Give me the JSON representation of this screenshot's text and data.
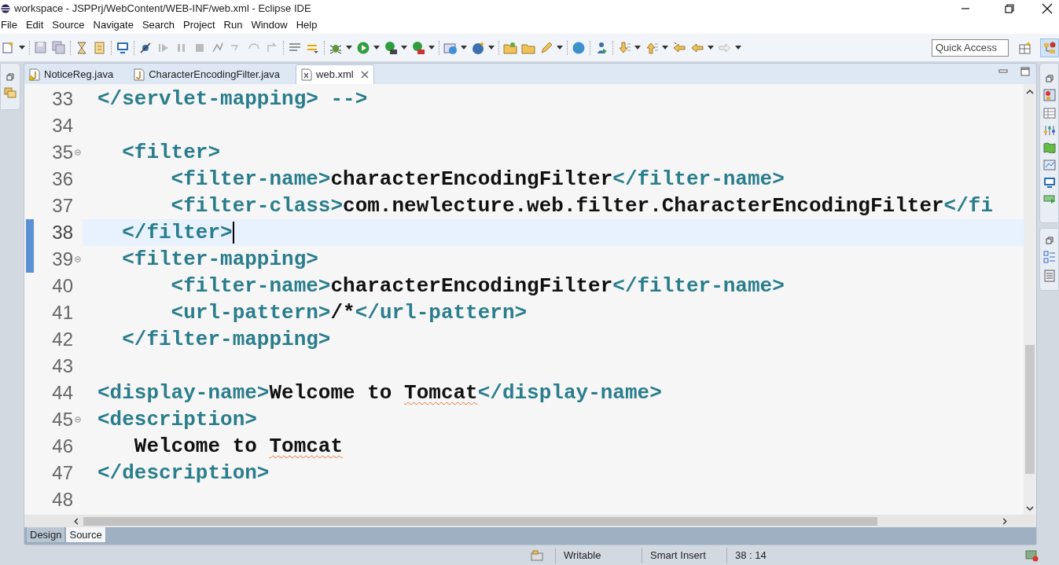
{
  "window": {
    "title": "workspace - JSPPrj/WebContent/WEB-INF/web.xml - Eclipse IDE"
  },
  "menu": [
    "File",
    "Edit",
    "Source",
    "Navigate",
    "Search",
    "Project",
    "Run",
    "Window",
    "Help"
  ],
  "quick_access": {
    "placeholder": "Quick Access"
  },
  "editor_tabs": [
    {
      "label": "NoticeReg.java",
      "kind": "java",
      "selected": false,
      "warning": true
    },
    {
      "label": "CharacterEncodingFilter.java",
      "kind": "java",
      "selected": false,
      "warning": false
    },
    {
      "label": "web.xml",
      "kind": "xml",
      "selected": true,
      "warning": false
    }
  ],
  "lines": [
    {
      "number": "33",
      "foldable": false,
      "current": false,
      "changed": false,
      "tokens": [
        {
          "kind": "tag",
          "text": "</servlet-mapping> -->"
        }
      ]
    },
    {
      "number": "34",
      "foldable": false,
      "current": false,
      "changed": false
    },
    {
      "number": "35",
      "foldable": true,
      "current": false,
      "changed": false,
      "tokens": [
        {
          "kind": "tag",
          "text": "  <filter>"
        }
      ]
    },
    {
      "number": "36",
      "foldable": false,
      "current": false,
      "changed": false,
      "tokens": [
        {
          "kind": "tag",
          "text": "      <filter-name>"
        },
        {
          "kind": "text",
          "text": "characterEncodingFilter"
        },
        {
          "kind": "tag",
          "text": "</filter-name>"
        }
      ]
    },
    {
      "number": "37",
      "foldable": false,
      "current": false,
      "changed": false,
      "tokens": [
        {
          "kind": "tag",
          "text": "      <filter-class>"
        },
        {
          "kind": "text",
          "text": "com.newlecture.web.filter.CharacterEncodingFilter"
        },
        {
          "kind": "tag",
          "text": "</fi"
        }
      ]
    },
    {
      "number": "38",
      "foldable": false,
      "current": true,
      "changed": true,
      "tokens": [
        {
          "kind": "tag",
          "text": "  </filter>"
        }
      ]
    },
    {
      "number": "39",
      "foldable": true,
      "current": false,
      "changed": true,
      "tokens": [
        {
          "kind": "tag",
          "text": "  <filter-mapping>"
        }
      ]
    },
    {
      "number": "40",
      "foldable": false,
      "current": false,
      "changed": false,
      "tokens": [
        {
          "kind": "tag",
          "text": "      <filter-name>"
        },
        {
          "kind": "text",
          "text": "characterEncodingFilter"
        },
        {
          "kind": "tag",
          "text": "</filter-name>"
        }
      ]
    },
    {
      "number": "41",
      "foldable": false,
      "current": false,
      "changed": false,
      "tokens": [
        {
          "kind": "tag",
          "text": "      <url-pattern>"
        },
        {
          "kind": "text",
          "text": "/*"
        },
        {
          "kind": "tag",
          "text": "</url-pattern>"
        }
      ]
    },
    {
      "number": "42",
      "foldable": false,
      "current": false,
      "changed": false,
      "tokens": [
        {
          "kind": "tag",
          "text": "  </filter-mapping>"
        }
      ]
    },
    {
      "number": "43",
      "foldable": false,
      "current": false,
      "changed": false
    },
    {
      "number": "44",
      "foldable": false,
      "current": false,
      "changed": false,
      "tokens": [
        {
          "kind": "tag",
          "text": "<display-name>"
        },
        {
          "kind": "text",
          "text": "Welcome to "
        },
        {
          "kind": "text",
          "text": "Tomcat",
          "spelling_error": true
        },
        {
          "kind": "tag",
          "text": "</display-name>"
        }
      ]
    },
    {
      "number": "45",
      "foldable": true,
      "current": false,
      "changed": false,
      "tokens": [
        {
          "kind": "tag",
          "text": "<description>"
        }
      ]
    },
    {
      "number": "46",
      "foldable": false,
      "current": false,
      "changed": false,
      "tokens": [
        {
          "kind": "text",
          "text": "   Welcome to "
        },
        {
          "kind": "text",
          "text": "Tomcat",
          "spelling_error": true
        }
      ]
    },
    {
      "number": "47",
      "foldable": false,
      "current": false,
      "changed": false,
      "tokens": [
        {
          "kind": "tag",
          "text": "</description>"
        }
      ]
    },
    {
      "number": "48",
      "foldable": false,
      "current": false,
      "changed": false
    }
  ],
  "view_tabs": [
    {
      "label": "Design",
      "selected": false
    },
    {
      "label": "Source",
      "selected": true
    }
  ],
  "status_bar": [
    "Writable",
    "Smart Insert",
    "38 : 14"
  ]
}
